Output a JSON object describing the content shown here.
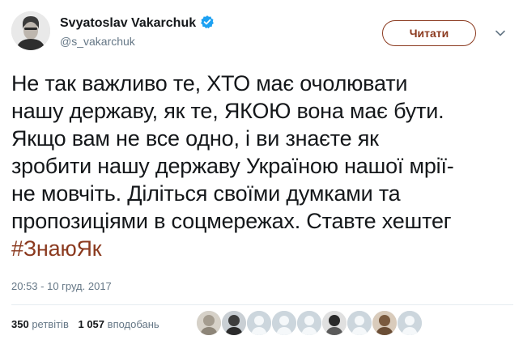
{
  "user": {
    "name": "Svyatoslav Vakarchuk",
    "handle": "@s_vakarchuk"
  },
  "follow_button": {
    "label": "Читати"
  },
  "tweet": {
    "lines": [
      "Не так важливо те, ХТО має очолювати",
      "нашу державу, як те, ЯКОЮ вона має бути.",
      "Якщо вам не все одно, і ви знаєте як",
      "зробити нашу державу Україною нашої мрії-",
      "не мовчіть. Діліться своїми  думками та",
      "пропозиціями в соцмережах. Ставте хештег"
    ],
    "hashtag": "#ЗнаюЯк",
    "timestamp": "20:53 - 10 груд. 2017"
  },
  "stats": {
    "retweets_count": "350",
    "retweets_label": "ретвітів",
    "likes_count": "1 057",
    "likes_label": "вподобань"
  },
  "colors": {
    "accent": "#8b3a1f",
    "verified": "#1da1f2",
    "secondary_text": "#657786"
  }
}
